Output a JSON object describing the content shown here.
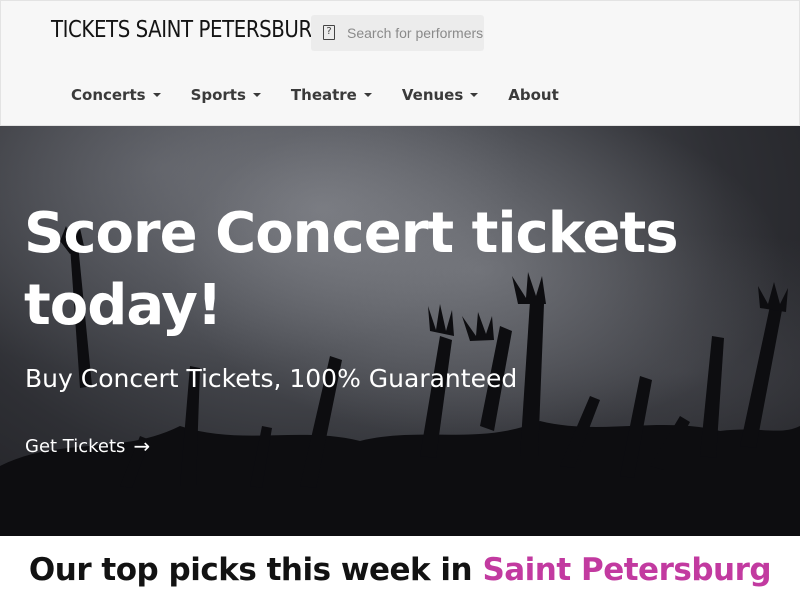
{
  "header": {
    "logo": "TICKETS SAINT PETERSBURG",
    "search": {
      "placeholder": "Search for performers",
      "icon": "search-icon"
    },
    "nav": [
      {
        "label": "Concerts",
        "dropdown": true
      },
      {
        "label": "Sports",
        "dropdown": true
      },
      {
        "label": "Theatre",
        "dropdown": true
      },
      {
        "label": "Venues",
        "dropdown": true
      },
      {
        "label": "About",
        "dropdown": false
      }
    ]
  },
  "hero": {
    "title": "Score Concert tickets today!",
    "subtitle": "Buy Concert Tickets, 100% Guaranteed",
    "cta_label": "Get Tickets",
    "cta_icon": "arrow-right-icon"
  },
  "picks": {
    "prefix": "Our top picks this week in",
    "city": "Saint Petersburg",
    "city_color": "#c23aa0"
  }
}
